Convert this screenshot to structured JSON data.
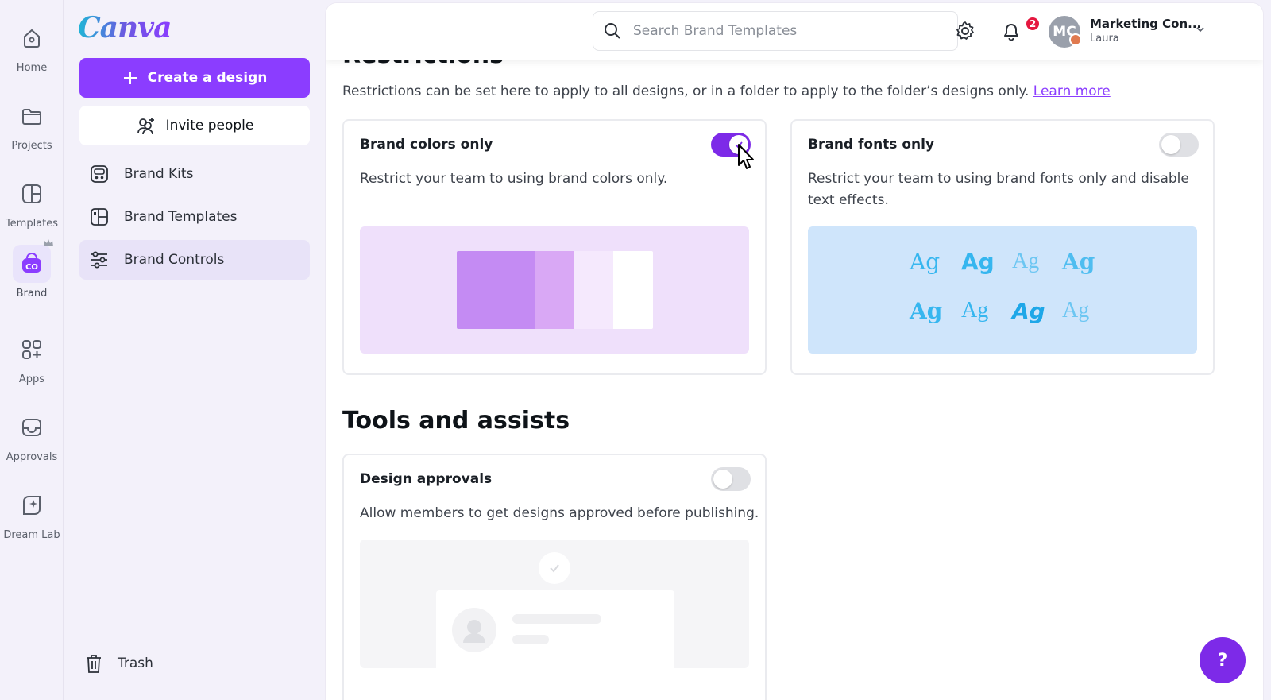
{
  "rail": {
    "items": [
      {
        "label": "Home",
        "icon": "home-icon"
      },
      {
        "label": "Projects",
        "icon": "folder-icon"
      },
      {
        "label": "Templates",
        "icon": "templates-icon"
      },
      {
        "label": "Brand",
        "icon": "brand-icon"
      },
      {
        "label": "Apps",
        "icon": "apps-icon"
      },
      {
        "label": "Approvals",
        "icon": "inbox-icon"
      },
      {
        "label": "Dream Lab",
        "icon": "dream-lab-icon"
      }
    ]
  },
  "sidebar": {
    "logo": "Canva",
    "create_label": "Create a design",
    "invite_label": "Invite people",
    "items": [
      {
        "label": "Brand Kits"
      },
      {
        "label": "Brand Templates"
      },
      {
        "label": "Brand Controls"
      }
    ],
    "trash_label": "Trash"
  },
  "topbar": {
    "search_placeholder": "Search Brand Templates",
    "notification_count": "2",
    "avatar_initials": "MC",
    "account_name": "Marketing Con...",
    "account_user": "Laura"
  },
  "main": {
    "section_title": "Restrictions",
    "description": "Restrictions can be set here to apply to all designs, or in a folder to apply to the folder’s designs only.",
    "learn_more": "Learn more",
    "cards": {
      "colors": {
        "title": "Brand colors only",
        "text": "Restrict your team to using brand colors only.",
        "enabled": true
      },
      "fonts": {
        "title": "Brand fonts only",
        "text": "Restrict your team to using brand fonts only and disable text effects.",
        "enabled": false,
        "samples": [
          "Ag",
          "Ag",
          "Ag",
          "Ag",
          "Ag",
          "Ag",
          "Ag",
          "Ag"
        ]
      },
      "approvals": {
        "title": "Design approvals",
        "text": "Allow members to get designs approved before publishing.",
        "enabled": false
      }
    },
    "tools_title": "Tools and assists"
  },
  "help_label": "?",
  "colors": {
    "accent": "#8b3dff",
    "toggle_on": "#7d2ae8",
    "badge": "#e5173f"
  }
}
